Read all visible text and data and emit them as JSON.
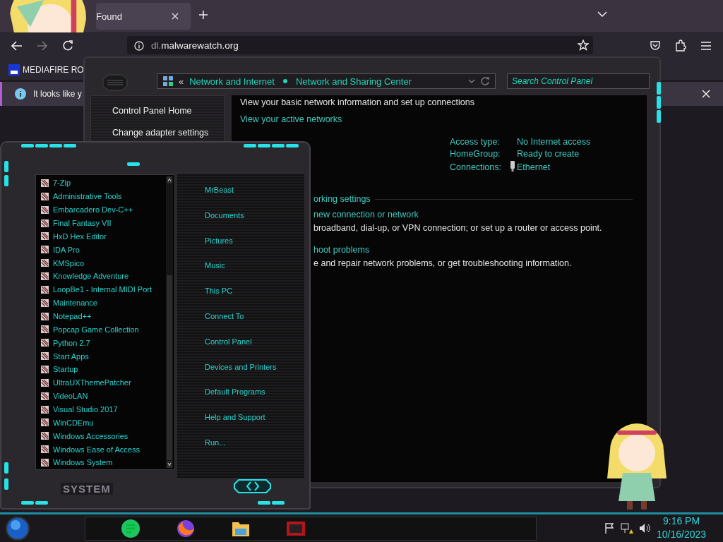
{
  "browser": {
    "tab": {
      "title": "Found",
      "selected": true
    },
    "url": {
      "host_dim": "dl.",
      "host": "malwarewatch.org"
    },
    "bookmarks": [
      {
        "label": "MEDIAFIRE RO"
      }
    ],
    "notice": {
      "text": "It looks like y"
    }
  },
  "control_panel": {
    "breadcrumb": {
      "prefix": "«",
      "items": [
        {
          "label": "Network and Internet"
        },
        {
          "label": "Network and Sharing Center"
        }
      ]
    },
    "search": {
      "placeholder": "Search Control Panel"
    },
    "sidebar": {
      "items": [
        {
          "label": "Control Panel Home"
        },
        {
          "label": "Change adapter settings"
        }
      ]
    },
    "heading": "View your basic network information and set up connections",
    "active_networks": "View your active networks",
    "info": [
      {
        "label": "Access type:",
        "value": "No Internet access",
        "kind": "text"
      },
      {
        "label": "HomeGroup:",
        "value": "Ready to create",
        "kind": "text"
      },
      {
        "label": "Connections:",
        "value": "Ethernet",
        "kind": "ethernet"
      }
    ],
    "change_settings": "orking settings",
    "tasks": [
      {
        "link": "new connection or network",
        "description": "broadband, dial-up, or VPN connection; or set up a router or access point."
      },
      {
        "link": "hoot problems",
        "description": "e and repair network problems, or get troubleshooting information."
      }
    ]
  },
  "start_menu": {
    "programs": [
      "7-Zip",
      "Administrative Tools",
      "Embarcadero Dev-C++",
      "Final Fantasy VII",
      "HxD Hex Editor",
      "IDA Pro",
      "KMSpico",
      "Knowledge Adventure",
      "LoopBe1 - Internal MIDI Port",
      "Maintenance",
      "Notepad++",
      "Popcap Game Collection",
      "Python 2.7",
      "Start Apps",
      "Startup",
      "UltraUXThemePatcher",
      "VideoLAN",
      "Visual Studio 2017",
      "WinCDEmu",
      "Windows Accessories",
      "Windows Ease of Access",
      "Windows System"
    ],
    "places": [
      "MrBeast",
      "Documents",
      "Pictures",
      "Music",
      "This PC",
      "Connect To",
      "Control Panel",
      "Devices and Printers",
      "Default Programs",
      "Help and Support",
      "Run..."
    ],
    "footer": "SYSTEM"
  },
  "taskbar": {
    "apps": [
      {
        "kind": "notes"
      },
      {
        "kind": "browser"
      },
      {
        "kind": "folder"
      },
      {
        "kind": "game"
      }
    ],
    "time": "9:16 PM",
    "date": "10/16/2023"
  }
}
